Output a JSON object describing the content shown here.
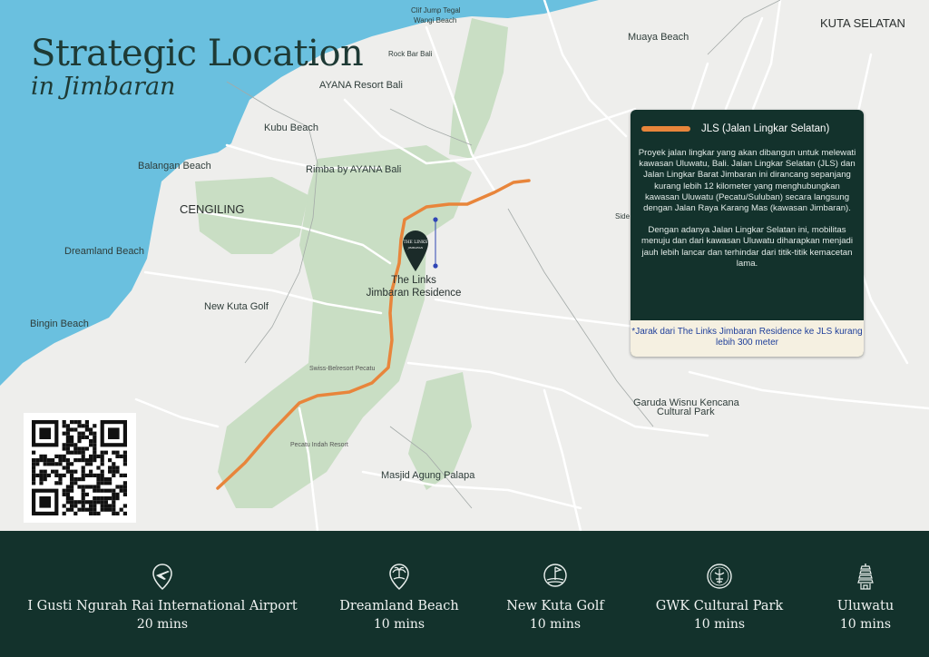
{
  "title": {
    "line1": "Strategic Location",
    "line2": "in Jimbaran"
  },
  "map_labels": {
    "clif_jump_1": "Clif Jump Tegal",
    "clif_jump_2": "Wangi Beach",
    "rock_bar": "Rock Bar Bali",
    "ayana": "AYANA Resort Bali",
    "muaya": "Muaya Beach",
    "kuta_selatan": "KUTA SELATAN",
    "kubu": "Kubu Beach",
    "balangan": "Balangan Beach",
    "rimba": "Rimba by AYANA Bali",
    "cengiling": "CENGILING",
    "dreamland": "Dreamland Beach",
    "new_kuta_golf": "New Kuta Golf",
    "bingin": "Bingin Beach",
    "swiss_belresort": "Swiss-Belresort Pecatu",
    "pecatu_indah": "Pecatu Indah Resort",
    "masjid": "Masjid Agung Palapa",
    "gwk_1": "Garuda Wisnu Kencana",
    "gwk_2": "Cultural Park",
    "side": "Side",
    "pin_line1": "The Links",
    "pin_line2": "Jimbaran Residence",
    "pin_logo_1": "THE LINKS",
    "pin_logo_2": "JIMBARAN"
  },
  "info_box": {
    "legend": "JLS (Jalan Lingkar Selatan)",
    "paragraph1": "Proyek jalan lingkar yang akan dibangun untuk melewati kawasan Uluwatu, Bali. Jalan Lingkar Selatan (JLS) dan Jalan Lingkar Barat Jimbaran ini dirancang sepanjang kurang lebih 12 kilometer yang menghubungkan kawasan Uluwatu (Pecatu/Suluban) secara langsung dengan Jalan Raya Karang Mas (kawasan Jimbaran).",
    "paragraph2": "Dengan adanya Jalan Lingkar Selatan ini, mobilitas menuju dan dari kawasan Uluwatu diharapkan menjadi jauh lebih lancar dan terhindar dari titik-titik kemacetan lama.",
    "note": "*Jarak dari The Links Jimbaran Residence ke JLS kurang lebih 300 meter"
  },
  "colors": {
    "sea": "#6ac0df",
    "land": "#eeeeec",
    "green_area": "#c9dec4",
    "road": "#e8853b",
    "panel": "#13322c",
    "note_bg": "#f5f0e1",
    "note_text": "#1f3f9a"
  },
  "destinations": [
    {
      "icon": "airplane-icon",
      "name": "I Gusti Ngurah Rai International Airport",
      "time": "20 mins"
    },
    {
      "icon": "beach-icon",
      "name": "Dreamland Beach",
      "time": "10 mins"
    },
    {
      "icon": "golf-icon",
      "name": "New Kuta Golf",
      "time": "10 mins"
    },
    {
      "icon": "statue-icon",
      "name": "GWK Cultural Park",
      "time": "10 mins"
    },
    {
      "icon": "temple-icon",
      "name": "Uluwatu",
      "time": "10 mins"
    }
  ]
}
